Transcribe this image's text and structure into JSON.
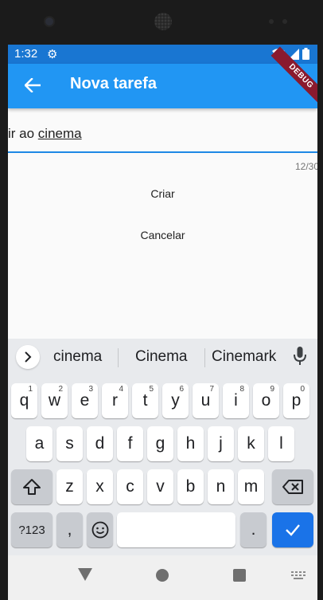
{
  "status": {
    "time": "1:32",
    "debug_label": "DEBUG"
  },
  "appbar": {
    "title": "Nova tarefa"
  },
  "field": {
    "prefix": "ir ao ",
    "value_tail": "cinema",
    "counter": "12/30"
  },
  "buttons": {
    "create": "Criar",
    "cancel": "Cancelar"
  },
  "keyboard": {
    "suggestions": [
      "cinema",
      "Cinema",
      "Cinemark"
    ],
    "row1": [
      {
        "k": "q",
        "h": "1"
      },
      {
        "k": "w",
        "h": "2"
      },
      {
        "k": "e",
        "h": "3"
      },
      {
        "k": "r",
        "h": "4"
      },
      {
        "k": "t",
        "h": "5"
      },
      {
        "k": "y",
        "h": "6"
      },
      {
        "k": "u",
        "h": "7"
      },
      {
        "k": "i",
        "h": "8"
      },
      {
        "k": "o",
        "h": "9"
      },
      {
        "k": "p",
        "h": "0"
      }
    ],
    "row2": [
      "a",
      "s",
      "d",
      "f",
      "g",
      "h",
      "j",
      "k",
      "l"
    ],
    "row3": [
      "z",
      "x",
      "c",
      "v",
      "b",
      "n",
      "m"
    ],
    "symbols": "?123",
    "comma": ",",
    "period": "."
  },
  "colors": {
    "appbar": "#2196f3",
    "statusbar": "#1976d2",
    "accent": "#1e88e5",
    "enter_key": "#1a73e8"
  }
}
